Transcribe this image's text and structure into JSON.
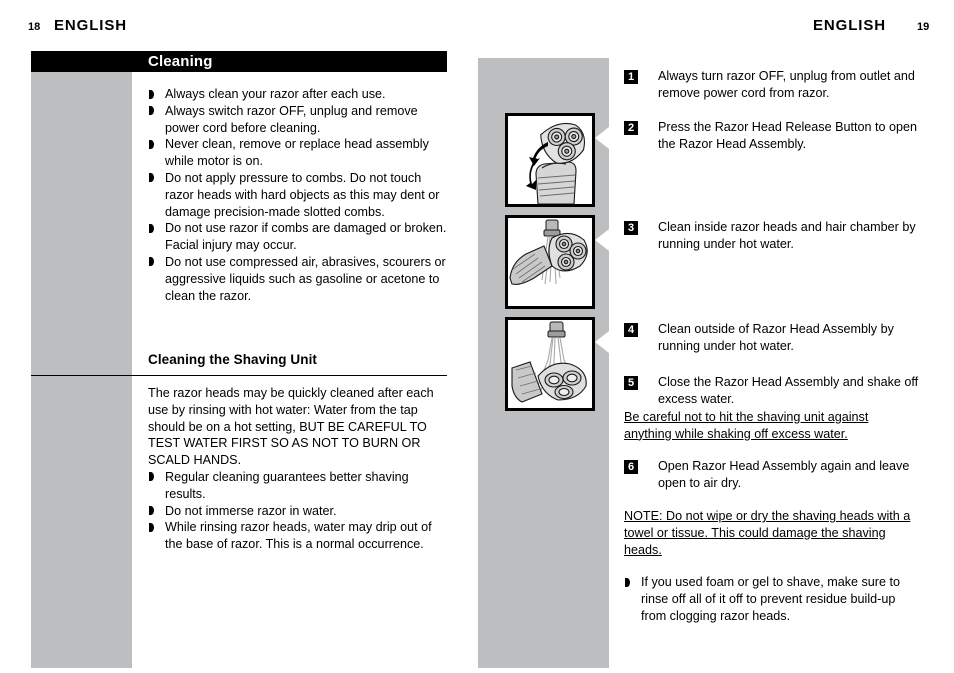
{
  "document": {
    "left_page": {
      "folio": "18",
      "running_head": "ENGLISH",
      "section_title": "Cleaning",
      "warnings": [
        "Always clean your razor after each use.",
        "Always switch razor OFF, unplug and remove power cord before cleaning.",
        "Never clean, remove or replace head assembly while motor is on.",
        "Do not apply pressure to combs.  Do not touch razor heads with hard objects as this may dent or damage precision-made slotted combs.",
        "Do not use razor if combs are damaged or broken. Facial injury may occur.",
        "Do not use compressed air, abrasives, scourers or aggressive liquids such as gasoline or acetone to clean the razor."
      ],
      "subhead": "Cleaning the Shaving Unit",
      "intro_paragraph": "The razor heads may be quickly cleaned after each use by rinsing with hot water: Water from the tap should be on a hot setting, BUT BE CAREFUL TO TEST WATER FIRST SO AS NOT TO BURN OR SCALD HANDS.",
      "tips": [
        "Regular cleaning guarantees better shaving results.",
        "Do not immerse razor in water.",
        "While rinsing razor heads, water may drip out of the base of razor. This is a normal occurrence."
      ]
    },
    "right_page": {
      "folio": "19",
      "running_head": "ENGLISH",
      "steps": [
        {
          "number": "1",
          "text": "Always turn razor OFF, unplug from outlet and remove power cord from razor."
        },
        {
          "number": "2",
          "text": "Press the Razor Head Release Button to open the Razor Head Assembly."
        },
        {
          "number": "3",
          "text": "Clean inside razor heads and hair chamber by running under hot water."
        },
        {
          "number": "4",
          "text": "Clean outside of Razor Head Assembly by running under hot water."
        },
        {
          "number": "5",
          "text": "Close the Razor Head Assembly and shake off excess water."
        },
        {
          "number": "6",
          "text": "Open Razor Head Assembly again and leave open to air dry."
        }
      ],
      "caution_after_step5": "Be careful not to hit the shaving unit against anything while shaking off excess water.",
      "note_after_step6": "NOTE: Do not wipe or dry the shaving heads with a towel or tissue. This could damage the shaving heads.",
      "final_bullets": [
        "If you used foam or gel to shave, make sure to rinse off all of it off to prevent residue build-up from clogging razor heads."
      ],
      "figures": [
        {
          "caption_ref": "2",
          "alt": "razor-head-assembly-open-illustration"
        },
        {
          "caption_ref": "3",
          "alt": "rinsing-inside-razor-heads-illustration"
        },
        {
          "caption_ref": "4",
          "alt": "rinsing-outside-razor-head-assembly-illustration"
        }
      ]
    },
    "colors": {
      "panel_gray": "#bcbec0",
      "bar_black": "#000000",
      "paper_white": "#ffffff"
    }
  }
}
